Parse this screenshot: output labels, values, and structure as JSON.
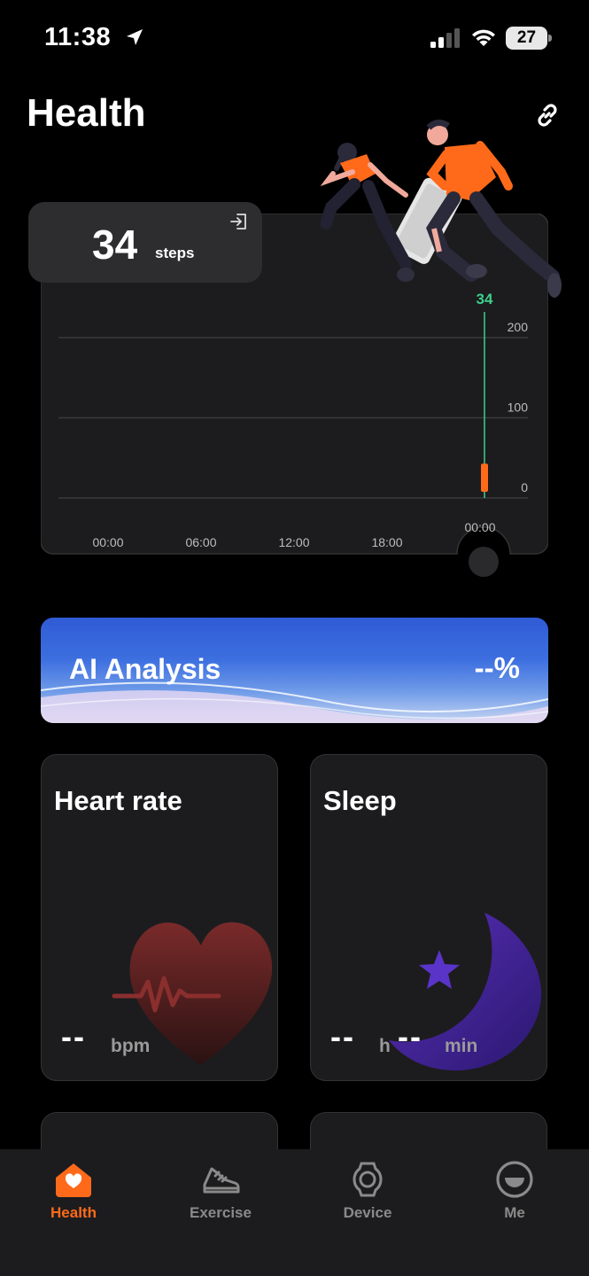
{
  "status_bar": {
    "time": "11:38",
    "battery": "27"
  },
  "header": {
    "title": "Health"
  },
  "steps_card": {
    "value": "34",
    "unit": "steps",
    "chart_data": {
      "type": "bar",
      "title": "",
      "xlabel": "",
      "ylabel": "",
      "x_ticks": [
        "00:00",
        "06:00",
        "12:00",
        "18:00"
      ],
      "y_ticks": [
        "200",
        "100",
        "0"
      ],
      "ylim": [
        0,
        200
      ],
      "grid": true,
      "bars": [
        {
          "x": "00:00",
          "value": 34
        }
      ],
      "selected": {
        "x_label": "00:00",
        "value_label": "34"
      }
    }
  },
  "ai_banner": {
    "title": "AI Analysis",
    "value": "--%"
  },
  "heart_card": {
    "title": "Heart rate",
    "value": "--",
    "unit": "bpm"
  },
  "sleep_card": {
    "title": "Sleep",
    "hours": "--",
    "hours_unit": "h",
    "minutes": "--",
    "minutes_unit": "min"
  },
  "tabs": [
    {
      "label": "Health",
      "icon": "house-heart-icon",
      "active": true
    },
    {
      "label": "Exercise",
      "icon": "sneaker-icon",
      "active": false
    },
    {
      "label": "Device",
      "icon": "watch-icon",
      "active": false
    },
    {
      "label": "Me",
      "icon": "face-icon",
      "active": false
    }
  ],
  "colors": {
    "accent": "#ff6a1a",
    "chart_line": "#3ecf8e",
    "card": "#1c1c1e"
  }
}
